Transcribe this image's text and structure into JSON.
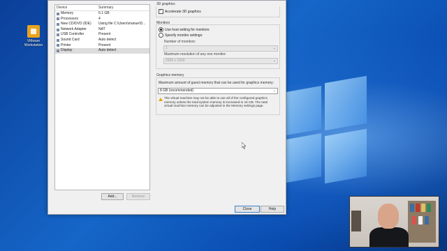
{
  "desktop": {
    "icon_label": "VMware Workstation"
  },
  "device_list": {
    "headers": {
      "device": "Device",
      "summary": "Summary"
    },
    "rows": [
      {
        "device": "Memory",
        "summary": "6.1 GB"
      },
      {
        "device": "Processors",
        "summary": "4"
      },
      {
        "device": "New CD/DVD (IDE)",
        "summary": "Using file C:\\Users\\manue\\D..."
      },
      {
        "device": "Network Adapter",
        "summary": "NAT"
      },
      {
        "device": "USB Controller",
        "summary": "Present"
      },
      {
        "device": "Sound Card",
        "summary": "Auto detect"
      },
      {
        "device": "Printer",
        "summary": "Present"
      },
      {
        "device": "Display",
        "summary": "Auto detect"
      }
    ],
    "selected_index": 7,
    "add_label": "Add...",
    "remove_label": "Remove"
  },
  "three_d": {
    "title": "3D graphics",
    "accelerate_label": "Accelerate 3D graphics",
    "accelerate_checked": true
  },
  "monitors": {
    "title": "Monitors",
    "use_host_label": "Use host setting for monitors",
    "specify_label": "Specify monitor settings:",
    "num_monitors_label": "Number of monitors:",
    "num_monitors_value": "1",
    "max_res_label": "Maximum resolution of any one monitor:",
    "max_res_value": "2560 x 1600"
  },
  "graphics_memory": {
    "title": "Graphics memory",
    "description": "Maximum amount of guest memory that can be used for graphics memory:",
    "value": "8 GB (recommended)",
    "warning_line1": "The virtual machine may not be able to use all of the configured graphics",
    "warning_line2": "memory unless the total system memory is increased to 16 GB. The total",
    "warning_line3": "virtual machine memory can be adjusted in the Memory settings page."
  },
  "footer": {
    "close_label": "Close",
    "help_label": "Help"
  }
}
